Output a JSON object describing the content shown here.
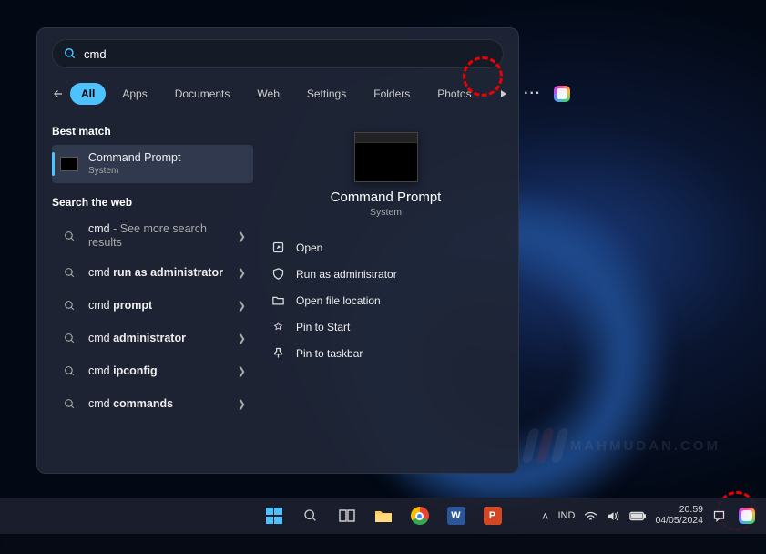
{
  "search": {
    "query": "cmd",
    "tabs": [
      "All",
      "Apps",
      "Documents",
      "Web",
      "Settings",
      "Folders",
      "Photos"
    ],
    "active_tab": 0
  },
  "best_match_label": "Best match",
  "best_match": {
    "title": "Command Prompt",
    "subtitle": "System"
  },
  "search_web_label": "Search the web",
  "web_results": [
    {
      "prefix": "cmd",
      "rest": " - See more search results"
    },
    {
      "prefix": "cmd ",
      "bold": "run as administrator"
    },
    {
      "prefix": "cmd ",
      "bold": "prompt"
    },
    {
      "prefix": "cmd ",
      "bold": "administrator"
    },
    {
      "prefix": "cmd ",
      "bold": "ipconfig"
    },
    {
      "prefix": "cmd ",
      "bold": "commands"
    }
  ],
  "preview": {
    "title": "Command Prompt",
    "subtitle": "System",
    "actions": [
      "Open",
      "Run as administrator",
      "Open file location",
      "Pin to Start",
      "Pin to taskbar"
    ]
  },
  "taskbar": {
    "tray": {
      "lang": "IND",
      "time": "20.59",
      "date": "04/05/2024",
      "chevron": "˄"
    }
  },
  "watermark_text": "MAHMUDAN.COM"
}
